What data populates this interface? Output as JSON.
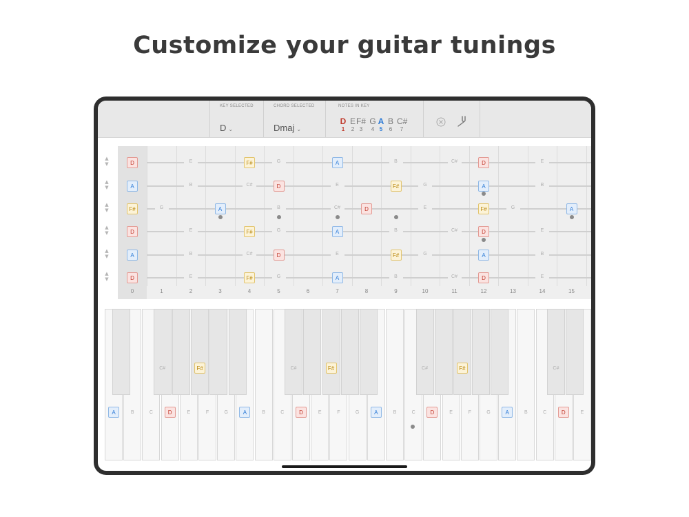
{
  "headline": "Customize your guitar tunings",
  "toolbar": {
    "key_label": "KEY SELECTED",
    "key_value": "D",
    "chord_label": "CHORD SELECTED",
    "chord_value": "Dmaj",
    "notes_label": "NOTES IN KEY",
    "chevron": "⌄",
    "notes": [
      {
        "name": "D",
        "degree": "1",
        "role": "root"
      },
      {
        "name": "E",
        "degree": "2",
        "role": ""
      },
      {
        "name": "F#",
        "degree": "3",
        "role": ""
      },
      {
        "name": "G",
        "degree": "4",
        "role": ""
      },
      {
        "name": "A",
        "degree": "5",
        "role": "fifth"
      },
      {
        "name": "B",
        "degree": "6",
        "role": ""
      },
      {
        "name": "C#",
        "degree": "7",
        "role": ""
      }
    ],
    "icons": {
      "clear": "close-circle-icon",
      "tuning": "tuning-fork-icon"
    }
  },
  "fretboard": {
    "fret_numbers": [
      "0",
      "1",
      "2",
      "3",
      "4",
      "5",
      "6",
      "7",
      "8",
      "9",
      "10",
      "11",
      "12",
      "13",
      "14",
      "15"
    ],
    "tune_arrow_up": "▲",
    "tune_arrow_down": "▼",
    "strings": [
      [
        [
          "D",
          "D"
        ],
        [
          "E",
          ""
        ],
        [
          "F#",
          "F"
        ],
        [
          "G",
          ""
        ],
        [
          "A",
          "A"
        ],
        [
          "B",
          ""
        ],
        [
          "C#",
          ""
        ],
        [
          "D",
          "D"
        ],
        [
          "E",
          ""
        ]
      ],
      [
        [
          "A",
          "A"
        ],
        [
          "B",
          ""
        ],
        [
          "C#",
          ""
        ],
        [
          "D",
          "D"
        ],
        [
          "E",
          ""
        ],
        [
          "F#",
          "F"
        ],
        [
          "G",
          ""
        ],
        [
          "A",
          "A"
        ],
        [
          "B",
          ""
        ]
      ],
      [
        [
          "F#",
          "F"
        ],
        [
          "G",
          ""
        ],
        [
          "A",
          "A"
        ],
        [
          "B",
          ""
        ],
        [
          "C#",
          ""
        ],
        [
          "D",
          "D"
        ],
        [
          "E",
          ""
        ],
        [
          "F#",
          "F"
        ],
        [
          "G",
          ""
        ],
        [
          "A",
          "A"
        ]
      ],
      [
        [
          "D",
          "D"
        ],
        [
          "E",
          ""
        ],
        [
          "F#",
          "F"
        ],
        [
          "G",
          ""
        ],
        [
          "A",
          "A"
        ],
        [
          "B",
          ""
        ],
        [
          "C#",
          ""
        ],
        [
          "D",
          "D"
        ],
        [
          "E",
          ""
        ]
      ],
      [
        [
          "A",
          "A"
        ],
        [
          "B",
          ""
        ],
        [
          "C#",
          ""
        ],
        [
          "D",
          "D"
        ],
        [
          "E",
          ""
        ],
        [
          "F#",
          "F"
        ],
        [
          "G",
          ""
        ],
        [
          "A",
          "A"
        ],
        [
          "B",
          ""
        ]
      ],
      [
        [
          "D",
          "D"
        ],
        [
          "E",
          ""
        ],
        [
          "F#",
          "F"
        ],
        [
          "G",
          ""
        ],
        [
          "A",
          "A"
        ],
        [
          "B",
          ""
        ],
        [
          "C#",
          ""
        ],
        [
          "D",
          "D"
        ],
        [
          "E",
          ""
        ]
      ]
    ]
  },
  "piano": {
    "white_labels": [
      "A",
      "B",
      "C",
      "D",
      "E",
      "F",
      "G",
      "A",
      "B",
      "C",
      "D",
      "E",
      "F",
      "G",
      "A",
      "B",
      "C",
      "D",
      "E",
      "F",
      "G",
      "A",
      "B",
      "C",
      "D",
      "E"
    ],
    "white_highlight": [
      "A",
      "",
      "",
      "D",
      "",
      "",
      "",
      "A",
      "",
      "",
      "D",
      "",
      "",
      "",
      "A",
      "",
      "",
      "D",
      "",
      "",
      "",
      "A",
      "",
      "",
      "D",
      ""
    ],
    "black_labels": [
      "",
      "C#",
      "",
      "F#",
      "",
      "",
      "C#",
      "",
      "F#",
      "",
      "",
      "C#",
      "",
      "F#",
      "",
      "",
      "C#",
      ""
    ],
    "black_highlight": [
      "",
      "",
      "",
      "F",
      "",
      "",
      "",
      "",
      "F",
      "",
      "",
      "",
      "",
      "F",
      "",
      "",
      "",
      ""
    ]
  }
}
